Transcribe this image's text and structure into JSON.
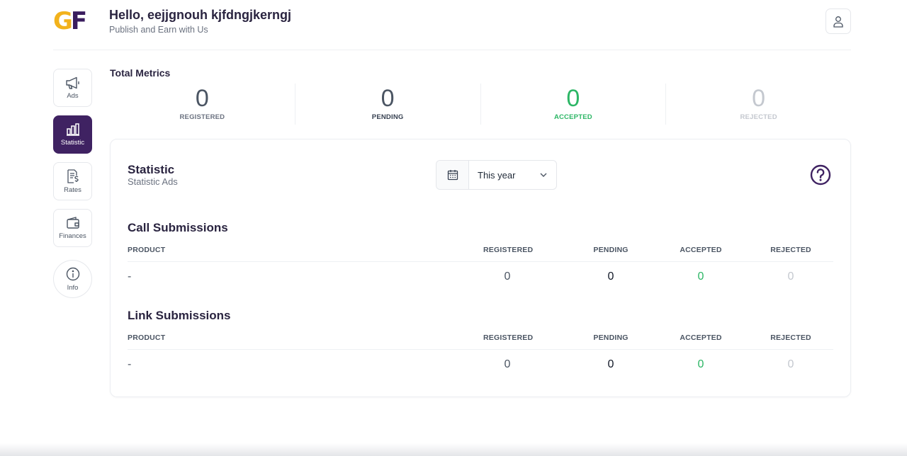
{
  "header": {
    "logo_g": "G",
    "logo_f": "F",
    "greeting": "Hello, eejjgnouh kjfdngjkerngj",
    "subtitle": "Publish and Earn with Us",
    "user_icon": "user-icon"
  },
  "sidebar": {
    "items": [
      {
        "label": "Ads",
        "icon": "megaphone-icon",
        "active": false
      },
      {
        "label": "Statistic",
        "icon": "bar-chart-icon",
        "active": true
      },
      {
        "label": "Rates",
        "icon": "receipt-dollar-icon",
        "active": false
      },
      {
        "label": "Finances",
        "icon": "wallet-icon",
        "active": false
      },
      {
        "label": "Info",
        "icon": "info-icon",
        "active": false
      }
    ]
  },
  "metrics": {
    "title": "Total Metrics",
    "items": [
      {
        "value": "0",
        "label": "REGISTERED"
      },
      {
        "value": "0",
        "label": "PENDING"
      },
      {
        "value": "0",
        "label": "ACCEPTED"
      },
      {
        "value": "0",
        "label": "REJECTED"
      }
    ]
  },
  "statistic": {
    "title": "Statistic",
    "subtitle": "Statistic Ads",
    "period": "This year",
    "help_icon": "help-circle-icon",
    "calendar_icon": "calendar-icon"
  },
  "call_submissions": {
    "title": "Call Submissions",
    "columns": [
      "PRODUCT",
      "REGISTERED",
      "PENDING",
      "ACCEPTED",
      "REJECTED"
    ],
    "rows": [
      {
        "product": "-",
        "registered": "0",
        "pending": "0",
        "accepted": "0",
        "rejected": "0"
      }
    ]
  },
  "link_submissions": {
    "title": "Link Submissions",
    "columns": [
      "PRODUCT",
      "REGISTERED",
      "PENDING",
      "ACCEPTED",
      "REJECTED"
    ],
    "rows": [
      {
        "product": "-",
        "registered": "0",
        "pending": "0",
        "accepted": "0",
        "rejected": "0"
      }
    ]
  },
  "colors": {
    "brand_purple": "#3f2262",
    "brand_yellow": "#f2b21c",
    "accepted_green": "#2cb665",
    "rejected_gray": "#c4c8cf"
  }
}
